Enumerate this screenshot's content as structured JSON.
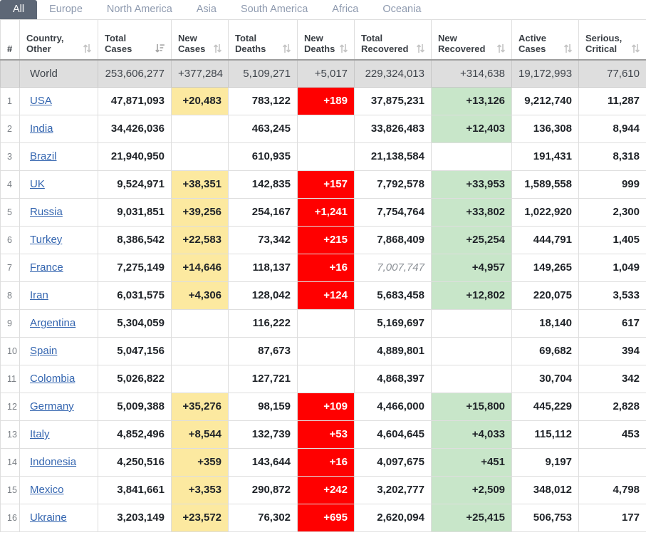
{
  "tabs": [
    {
      "label": "All",
      "active": true
    },
    {
      "label": "Europe",
      "active": false
    },
    {
      "label": "North America",
      "active": false
    },
    {
      "label": "Asia",
      "active": false
    },
    {
      "label": "South America",
      "active": false
    },
    {
      "label": "Africa",
      "active": false
    },
    {
      "label": "Oceania",
      "active": false
    }
  ],
  "columns": [
    {
      "label": "#",
      "line1": "",
      "line2": "#",
      "sort": "none"
    },
    {
      "label": "Country, Other",
      "line1": "Country,",
      "line2": "Other",
      "sort": "sort-icon"
    },
    {
      "label": "Total Cases",
      "line1": "Total",
      "line2": "Cases",
      "sort": "sort-amount-desc-icon"
    },
    {
      "label": "New Cases",
      "line1": "New",
      "line2": "Cases",
      "sort": "sort-icon"
    },
    {
      "label": "Total Deaths",
      "line1": "Total",
      "line2": "Deaths",
      "sort": "sort-icon"
    },
    {
      "label": "New Deaths",
      "line1": "New",
      "line2": "Deaths",
      "sort": "sort-icon"
    },
    {
      "label": "Total Recovered",
      "line1": "Total",
      "line2": "Recovered",
      "sort": "sort-icon"
    },
    {
      "label": "New Recovered",
      "line1": "New",
      "line2": "Recovered",
      "sort": "sort-icon"
    },
    {
      "label": "Active Cases",
      "line1": "Active",
      "line2": "Cases",
      "sort": "sort-icon"
    },
    {
      "label": "Serious, Critical",
      "line1": "Serious,",
      "line2": "Critical",
      "sort": "sort-icon"
    }
  ],
  "world": {
    "rank": "",
    "country": "World",
    "total_cases": "253,606,277",
    "new_cases": "+377,284",
    "total_deaths": "5,109,271",
    "new_deaths": "+5,017",
    "total_recovered": "229,324,013",
    "new_recovered": "+314,638",
    "active_cases": "19,172,993",
    "serious_critical": "77,610"
  },
  "rows": [
    {
      "rank": "1",
      "country": "USA",
      "total_cases": "47,871,093",
      "new_cases": "+20,483",
      "total_deaths": "783,122",
      "new_deaths": "+189",
      "total_recovered": "37,875,231",
      "recovered_estimate": false,
      "new_recovered": "+13,126",
      "active_cases": "9,212,740",
      "serious_critical": "11,287"
    },
    {
      "rank": "2",
      "country": "India",
      "total_cases": "34,426,036",
      "new_cases": "",
      "total_deaths": "463,245",
      "new_deaths": "",
      "total_recovered": "33,826,483",
      "recovered_estimate": false,
      "new_recovered": "+12,403",
      "active_cases": "136,308",
      "serious_critical": "8,944"
    },
    {
      "rank": "3",
      "country": "Brazil",
      "total_cases": "21,940,950",
      "new_cases": "",
      "total_deaths": "610,935",
      "new_deaths": "",
      "total_recovered": "21,138,584",
      "recovered_estimate": false,
      "new_recovered": "",
      "active_cases": "191,431",
      "serious_critical": "8,318"
    },
    {
      "rank": "4",
      "country": "UK",
      "total_cases": "9,524,971",
      "new_cases": "+38,351",
      "total_deaths": "142,835",
      "new_deaths": "+157",
      "total_recovered": "7,792,578",
      "recovered_estimate": false,
      "new_recovered": "+33,953",
      "active_cases": "1,589,558",
      "serious_critical": "999"
    },
    {
      "rank": "5",
      "country": "Russia",
      "total_cases": "9,031,851",
      "new_cases": "+39,256",
      "total_deaths": "254,167",
      "new_deaths": "+1,241",
      "total_recovered": "7,754,764",
      "recovered_estimate": false,
      "new_recovered": "+33,802",
      "active_cases": "1,022,920",
      "serious_critical": "2,300"
    },
    {
      "rank": "6",
      "country": "Turkey",
      "total_cases": "8,386,542",
      "new_cases": "+22,583",
      "total_deaths": "73,342",
      "new_deaths": "+215",
      "total_recovered": "7,868,409",
      "recovered_estimate": false,
      "new_recovered": "+25,254",
      "active_cases": "444,791",
      "serious_critical": "1,405"
    },
    {
      "rank": "7",
      "country": "France",
      "total_cases": "7,275,149",
      "new_cases": "+14,646",
      "total_deaths": "118,137",
      "new_deaths": "+16",
      "total_recovered": "7,007,747",
      "recovered_estimate": true,
      "new_recovered": "+4,957",
      "active_cases": "149,265",
      "serious_critical": "1,049"
    },
    {
      "rank": "8",
      "country": "Iran",
      "total_cases": "6,031,575",
      "new_cases": "+4,306",
      "total_deaths": "128,042",
      "new_deaths": "+124",
      "total_recovered": "5,683,458",
      "recovered_estimate": false,
      "new_recovered": "+12,802",
      "active_cases": "220,075",
      "serious_critical": "3,533"
    },
    {
      "rank": "9",
      "country": "Argentina",
      "total_cases": "5,304,059",
      "new_cases": "",
      "total_deaths": "116,222",
      "new_deaths": "",
      "total_recovered": "5,169,697",
      "recovered_estimate": false,
      "new_recovered": "",
      "active_cases": "18,140",
      "serious_critical": "617"
    },
    {
      "rank": "10",
      "country": "Spain",
      "total_cases": "5,047,156",
      "new_cases": "",
      "total_deaths": "87,673",
      "new_deaths": "",
      "total_recovered": "4,889,801",
      "recovered_estimate": false,
      "new_recovered": "",
      "active_cases": "69,682",
      "serious_critical": "394"
    },
    {
      "rank": "11",
      "country": "Colombia",
      "total_cases": "5,026,822",
      "new_cases": "",
      "total_deaths": "127,721",
      "new_deaths": "",
      "total_recovered": "4,868,397",
      "recovered_estimate": false,
      "new_recovered": "",
      "active_cases": "30,704",
      "serious_critical": "342"
    },
    {
      "rank": "12",
      "country": "Germany",
      "total_cases": "5,009,388",
      "new_cases": "+35,276",
      "total_deaths": "98,159",
      "new_deaths": "+109",
      "total_recovered": "4,466,000",
      "recovered_estimate": false,
      "new_recovered": "+15,800",
      "active_cases": "445,229",
      "serious_critical": "2,828"
    },
    {
      "rank": "13",
      "country": "Italy",
      "total_cases": "4,852,496",
      "new_cases": "+8,544",
      "total_deaths": "132,739",
      "new_deaths": "+53",
      "total_recovered": "4,604,645",
      "recovered_estimate": false,
      "new_recovered": "+4,033",
      "active_cases": "115,112",
      "serious_critical": "453"
    },
    {
      "rank": "14",
      "country": "Indonesia",
      "total_cases": "4,250,516",
      "new_cases": "+359",
      "total_deaths": "143,644",
      "new_deaths": "+16",
      "total_recovered": "4,097,675",
      "recovered_estimate": false,
      "new_recovered": "+451",
      "active_cases": "9,197",
      "serious_critical": ""
    },
    {
      "rank": "15",
      "country": "Mexico",
      "total_cases": "3,841,661",
      "new_cases": "+3,353",
      "total_deaths": "290,872",
      "new_deaths": "+242",
      "total_recovered": "3,202,777",
      "recovered_estimate": false,
      "new_recovered": "+2,509",
      "active_cases": "348,012",
      "serious_critical": "4,798"
    },
    {
      "rank": "16",
      "country": "Ukraine",
      "total_cases": "3,203,149",
      "new_cases": "+23,572",
      "total_deaths": "76,302",
      "new_deaths": "+695",
      "total_recovered": "2,620,094",
      "recovered_estimate": false,
      "new_recovered": "+25,415",
      "active_cases": "506,753",
      "serious_critical": "177"
    }
  ],
  "colors": {
    "new_cases_bg": "#fce9a0",
    "new_deaths_bg": "#ff0000",
    "new_recovered_bg": "#c8e6c9",
    "world_row_bg": "#dedede",
    "active_tab_bg": "#5d6776",
    "tab_text": "#8e9aaf",
    "link": "#3566b0",
    "estimate_text": "#8a8f95"
  }
}
